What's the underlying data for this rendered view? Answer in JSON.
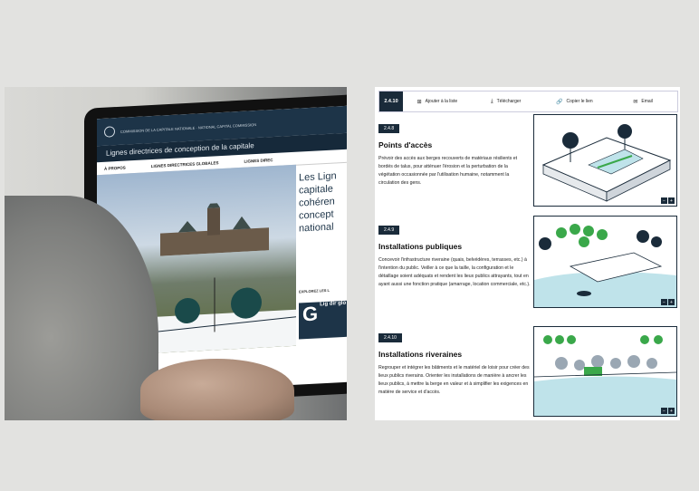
{
  "photo": {
    "ncc_org": "COMMISSION DE LA CAPITALE NATIONALE · NATIONAL CAPITAL COMMISSION",
    "site_title": "Lignes directrices de conception de la capitale",
    "nav": [
      "À PROPOS",
      "LIGNES DIRECTRICES GLOBALES",
      "LIGNES DIREC"
    ],
    "hero_text": [
      "Les Lign",
      "capitale",
      "cohéren",
      "concept",
      "national"
    ],
    "explore": "EXPLOREZ LES L",
    "tile_letter": "G",
    "tile_text": "Lig dir glo"
  },
  "toolbar": {
    "code": "2.4.10",
    "buttons": [
      {
        "label": "Ajouter à la liste",
        "icon": "list-add-icon",
        "glyph": "⊞"
      },
      {
        "label": "Télécharger",
        "icon": "download-icon",
        "glyph": "⤓"
      },
      {
        "label": "Copier le lien",
        "icon": "link-icon",
        "glyph": "🔗"
      },
      {
        "label": "Email",
        "icon": "email-icon",
        "glyph": "✉"
      }
    ]
  },
  "sections": [
    {
      "code": "2.4.8",
      "title": "Points d'accès",
      "body": "Prévoir des accès aux berges recouverts de matériaux résilients et bordés de talus, pour atténuer l'érosion et la perturbation de la végétation occasionnée par l'utilisation humaine, notamment la circulation des gens."
    },
    {
      "code": "2.4.9",
      "title": "Installations publiques",
      "body": "Concevoir l'infrastructure riveraine (quais, belvédères, terrasses, etc.) à l'intention du public. Veiller à ce que la taille, la configuration et le détaillage soient adéquats et rendent les lieux publics attrayants, tout en ayant aussi une fonction pratique (amarrage, location commerciale, etc.)."
    },
    {
      "code": "2.4.10",
      "title": "Installations riveraines",
      "body": "Regrouper et intégrer les bâtiments et le matériel de loisir pour créer des lieux publics riverains. Orienter les installations de manière à ancrer les lieux publics, à mettre la berge en valeur et à simplifier les exigences en matière de service et d'accès."
    }
  ],
  "zoom": {
    "minus": "−",
    "plus": "+"
  },
  "colors": {
    "navy": "#1a2b3a",
    "accent_green": "#3aa84a",
    "water": "#bfe3ea"
  }
}
